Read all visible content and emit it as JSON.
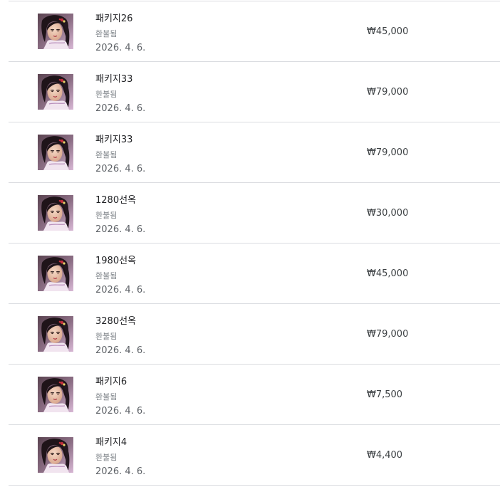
{
  "purchases": [
    {
      "title": "패키지26",
      "status": "환불됨",
      "date": "2026. 4. 6.",
      "price": "₩45,000"
    },
    {
      "title": "패키지33",
      "status": "환불됨",
      "date": "2026. 4. 6.",
      "price": "₩79,000"
    },
    {
      "title": "패키지33",
      "status": "환불됨",
      "date": "2026. 4. 6.",
      "price": "₩79,000"
    },
    {
      "title": "1280선옥",
      "status": "환불됨",
      "date": "2026. 4. 6.",
      "price": "₩30,000"
    },
    {
      "title": "1980선옥",
      "status": "환불됨",
      "date": "2026. 4. 6.",
      "price": "₩45,000"
    },
    {
      "title": "3280선옥",
      "status": "환불됨",
      "date": "2026. 4. 6.",
      "price": "₩79,000"
    },
    {
      "title": "패키지6",
      "status": "환불됨",
      "date": "2026. 4. 6.",
      "price": "₩7,500"
    },
    {
      "title": "패키지4",
      "status": "환불됨",
      "date": "2026. 4. 6.",
      "price": "₩4,400"
    }
  ],
  "icon": "game-app-icon"
}
